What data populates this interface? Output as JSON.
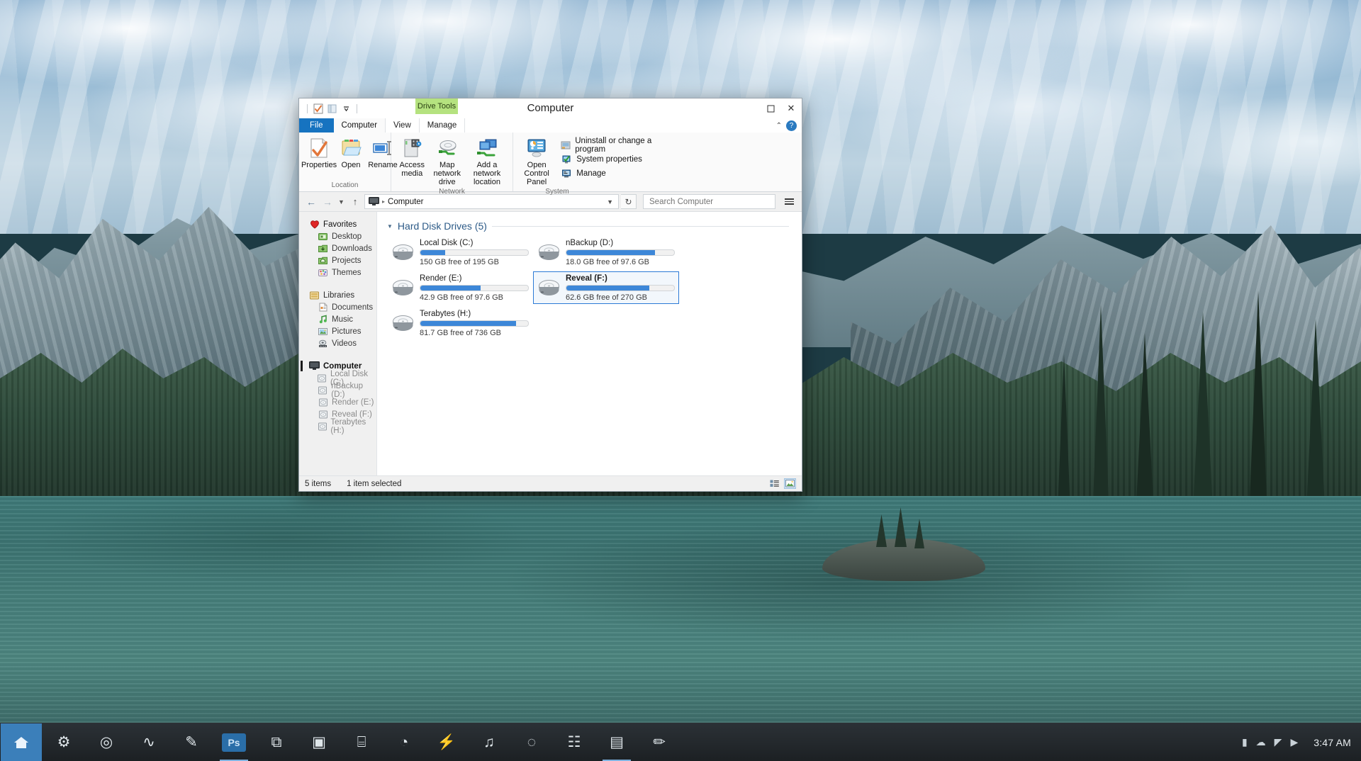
{
  "desktop": {
    "wallpaper_name": "maligne-lake-spirit-island"
  },
  "window": {
    "title": "Computer",
    "quick_access": {
      "properties_icon": "properties-icon",
      "folder_icon": "folder-icon",
      "dropdown_icon": "chevron-down-icon"
    },
    "contextual_tab_group": "Drive Tools",
    "controls": {
      "minimize": "–",
      "maximize": "☐",
      "close": "✕",
      "collapse_ribbon": "⌃",
      "help": "?"
    },
    "tabs": [
      {
        "label": "File",
        "kind": "file"
      },
      {
        "label": "Computer",
        "kind": "active"
      },
      {
        "label": "View",
        "kind": "normal"
      },
      {
        "label": "Manage",
        "kind": "contextual"
      }
    ],
    "ribbon": {
      "groups": [
        {
          "label": "Location",
          "buttons": [
            {
              "label": "Properties",
              "icon": "properties-icon",
              "split": false
            },
            {
              "label": "Open",
              "icon": "open-folder-icon",
              "split": false
            },
            {
              "label": "Rename",
              "icon": "rename-icon",
              "split": false
            }
          ]
        },
        {
          "label": "Network",
          "buttons": [
            {
              "label": "Access media",
              "icon": "media-device-icon",
              "split": true
            },
            {
              "label": "Map network drive",
              "icon": "map-drive-icon",
              "split": true
            },
            {
              "label": "Add a network location",
              "icon": "network-location-icon",
              "split": false
            }
          ]
        },
        {
          "label": "System",
          "buttons": [
            {
              "label": "Open Control Panel",
              "icon": "control-panel-icon",
              "split": false
            }
          ],
          "list": [
            {
              "label": "Uninstall or change a program",
              "icon": "uninstall-icon"
            },
            {
              "label": "System properties",
              "icon": "system-properties-icon"
            },
            {
              "label": "Manage",
              "icon": "manage-icon"
            }
          ]
        }
      ]
    },
    "address_bar": {
      "back_icon": "back-arrow-icon",
      "forward_icon": "forward-arrow-icon",
      "history_icon": "chevron-down-icon",
      "up_icon": "up-arrow-icon",
      "computer_icon": "computer-icon",
      "path_separator": "▸",
      "crumb": "Computer",
      "dropdown_icon": "chevron-down-icon",
      "refresh_icon": "refresh-icon",
      "search_placeholder": "Search Computer",
      "search_value": "",
      "options_icon": "hamburger-icon"
    },
    "nav_pane": {
      "sections": [
        {
          "header": {
            "label": "Favorites",
            "icon": "heart-icon"
          },
          "items": [
            {
              "label": "Desktop",
              "icon": "desktop-folder-icon"
            },
            {
              "label": "Downloads",
              "icon": "downloads-folder-icon"
            },
            {
              "label": "Projects",
              "icon": "projects-folder-icon"
            },
            {
              "label": "Themes",
              "icon": "themes-folder-icon"
            }
          ]
        },
        {
          "header": {
            "label": "Libraries",
            "icon": "libraries-icon"
          },
          "items": [
            {
              "label": "Documents",
              "icon": "documents-icon"
            },
            {
              "label": "Music",
              "icon": "music-icon"
            },
            {
              "label": "Pictures",
              "icon": "pictures-icon"
            },
            {
              "label": "Videos",
              "icon": "videos-icon"
            }
          ]
        },
        {
          "header": {
            "label": "Computer",
            "icon": "computer-icon",
            "selected": true
          },
          "items": [
            {
              "label": "Local Disk (C:)",
              "icon": "drive-icon"
            },
            {
              "label": "nBackup (D:)",
              "icon": "drive-icon"
            },
            {
              "label": "Render (E:)",
              "icon": "drive-icon"
            },
            {
              "label": "Reveal (F:)",
              "icon": "drive-icon"
            },
            {
              "label": "Terabytes (H:)",
              "icon": "drive-icon"
            }
          ]
        }
      ]
    },
    "content": {
      "group_title": "Hard Disk Drives (5)",
      "drives": [
        {
          "name": "Local Disk (C:)",
          "free_text": "150 GB free of 195 GB",
          "used_pct": 23,
          "bar_color": "#3d87d8",
          "selected": false
        },
        {
          "name": "nBackup (D:)",
          "free_text": "18.0 GB free of 97.6 GB",
          "used_pct": 82,
          "bar_color": "#3d87d8",
          "selected": false
        },
        {
          "name": "Render (E:)",
          "free_text": "42.9 GB free of 97.6 GB",
          "used_pct": 56,
          "bar_color": "#3d87d8",
          "selected": false
        },
        {
          "name": "Reveal (F:)",
          "free_text": "62.6 GB free of 270 GB",
          "used_pct": 77,
          "bar_color": "#3d87d8",
          "selected": true
        },
        {
          "name": "Terabytes (H:)",
          "free_text": "81.7 GB free of 736 GB",
          "used_pct": 89,
          "bar_color": "#3d87d8",
          "selected": false
        }
      ]
    },
    "status_bar": {
      "item_count": "5 items",
      "selection": "1 item selected",
      "details_view_icon": "details-view-icon",
      "tiles_view_icon": "large-icons-view-icon"
    }
  },
  "taskbar": {
    "items": [
      {
        "name": "start-button",
        "glyph": "⌂",
        "kind": "start"
      },
      {
        "name": "settings-app",
        "glyph": "⚙",
        "kind": "icon"
      },
      {
        "name": "chrome-app",
        "glyph": "◎",
        "kind": "icon"
      },
      {
        "name": "monitor-app",
        "glyph": "∿",
        "kind": "icon"
      },
      {
        "name": "notes-app",
        "glyph": "✎",
        "kind": "icon"
      },
      {
        "name": "photoshop-app",
        "glyph": "Ps",
        "kind": "ps",
        "active": true
      },
      {
        "name": "clipboard-app",
        "glyph": "⧉",
        "kind": "icon"
      },
      {
        "name": "video-app",
        "glyph": "▣",
        "kind": "icon"
      },
      {
        "name": "archive-app",
        "glyph": "⌸",
        "kind": "icon"
      },
      {
        "name": "blender-app",
        "glyph": "◔",
        "kind": "icon"
      },
      {
        "name": "power-app",
        "glyph": "⚡",
        "kind": "icon"
      },
      {
        "name": "music-app",
        "glyph": "♫",
        "kind": "icon"
      },
      {
        "name": "search-app",
        "glyph": "◌",
        "kind": "icon"
      },
      {
        "name": "calculator-app",
        "glyph": "☷",
        "kind": "icon"
      },
      {
        "name": "explorer-app",
        "glyph": "▤",
        "kind": "icon",
        "active": true
      },
      {
        "name": "editor-app",
        "glyph": "✏",
        "kind": "icon"
      }
    ],
    "tray": [
      {
        "name": "battery-icon",
        "glyph": "▮"
      },
      {
        "name": "onedrive-icon",
        "glyph": "☁"
      },
      {
        "name": "network-icon",
        "glyph": "◤"
      },
      {
        "name": "volume-icon",
        "glyph": "▶"
      }
    ],
    "clock": "3:47 AM"
  }
}
